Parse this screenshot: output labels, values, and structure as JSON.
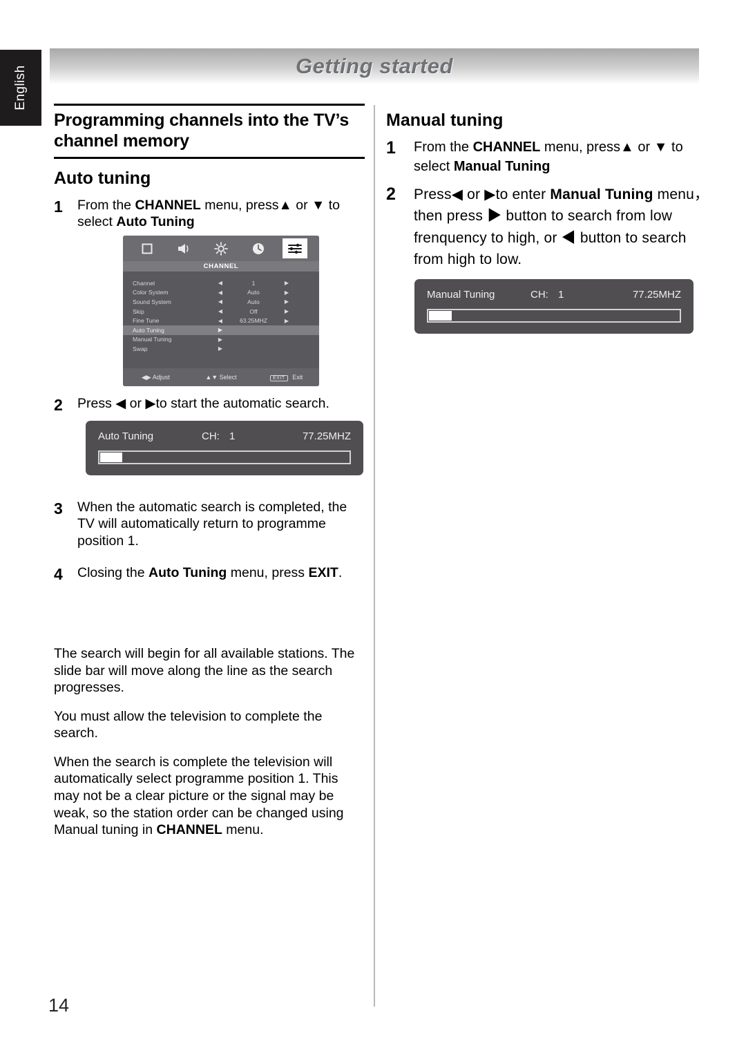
{
  "language_tab": "English",
  "header": {
    "title": "Getting started"
  },
  "page_number": "14",
  "left": {
    "section_title": "Programming channels into the TV’s channel memory",
    "subsection_title": "Auto tuning",
    "steps": [
      {
        "num": "1",
        "parts": [
          {
            "t": "From the ",
            "b": false
          },
          {
            "t": "CHANNEL",
            "b": true
          },
          {
            "t": " menu, press",
            "b": false
          },
          {
            "t": "▲",
            "b": false
          },
          {
            "t": " or ",
            "b": false
          },
          {
            "t": "▼",
            "b": false
          },
          {
            "t": " to select ",
            "b": false
          },
          {
            "t": "Auto Tuning",
            "b": true
          }
        ]
      },
      {
        "num": "2",
        "parts": [
          {
            "t": "Press ",
            "b": false
          },
          {
            "t": "◀",
            "b": false
          },
          {
            "t": " or ",
            "b": false
          },
          {
            "t": "▶",
            "b": false
          },
          {
            "t": "to start the automatic search.",
            "b": false
          }
        ]
      },
      {
        "num": "3",
        "parts": [
          {
            "t": "When the automatic search is completed, the TV will automatically return to programme position 1.",
            "b": false
          }
        ]
      },
      {
        "num": "4",
        "parts": [
          {
            "t": "Closing the ",
            "b": false
          },
          {
            "t": "Auto Tuning",
            "b": true
          },
          {
            "t": " menu, press ",
            "b": false
          },
          {
            "t": "EXIT",
            "b": true
          },
          {
            "t": ".",
            "b": false
          }
        ]
      }
    ],
    "paragraphs": [
      [
        {
          "t": "The search will begin for all available stations. The slide bar will move along the line as the search progresses.",
          "b": false
        }
      ],
      [
        {
          "t": "You must allow the television to complete the search.",
          "b": false
        }
      ],
      [
        {
          "t": "When the search is complete the television will automatically select programme position 1. This may not be a clear picture or the signal may be weak, so the station order can be changed using Manual tuning in ",
          "b": false
        },
        {
          "t": "CHANNEL",
          "b": true
        },
        {
          "t": " menu.",
          "b": false
        }
      ]
    ],
    "auto_tuning_box": {
      "name": "Auto Tuning",
      "ch_label": "CH:",
      "ch_value": "1",
      "frequency": "77.25MHZ",
      "progress_percent": 9
    }
  },
  "right": {
    "subsection_title": "Manual tuning",
    "steps": [
      {
        "num": "1",
        "parts": [
          {
            "t": "From the  ",
            "b": false
          },
          {
            "t": "CHANNEL",
            "b": true
          },
          {
            "t": " menu, press",
            "b": false
          },
          {
            "t": "▲",
            "b": false
          },
          {
            "t": " or ",
            "b": false
          },
          {
            "t": "▼",
            "b": false
          },
          {
            "t": " to select ",
            "b": false
          },
          {
            "t": "Manual Tuning",
            "b": true
          }
        ]
      },
      {
        "num": "2",
        "parts": [
          {
            "t": "Press",
            "b": false
          },
          {
            "t": "◀",
            "b": false
          },
          {
            "t": "  or ",
            "b": false
          },
          {
            "t": "▶",
            "b": false
          },
          {
            "t": "to enter  ",
            "b": false
          },
          {
            "t": "Manual Tuning",
            "b": true
          },
          {
            "t": " menu， then press ",
            "b": false
          },
          {
            "t": "▶",
            "b": false
          },
          {
            "t": " button to search from low frenquency to high, or ",
            "b": false
          },
          {
            "t": "◀",
            "b": false
          },
          {
            "t": " button to search from high to low.",
            "b": false
          }
        ]
      }
    ],
    "manual_tuning_box": {
      "name": "Manual Tuning",
      "ch_label": "CH:",
      "ch_value": "1",
      "frequency": "77.25MHZ",
      "progress_percent": 9
    }
  },
  "osd": {
    "icons": [
      {
        "name": "picture-icon",
        "active": false
      },
      {
        "name": "sound-icon",
        "active": false
      },
      {
        "name": "brightness-icon",
        "active": false
      },
      {
        "name": "time-icon",
        "active": false
      },
      {
        "name": "channel-settings-icon",
        "active": true
      }
    ],
    "menu_title": "CHANNEL",
    "rows": [
      {
        "label": "Channel",
        "left_arrow": "◀",
        "value": "1",
        "right_arrow": "▶",
        "highlighted": false
      },
      {
        "label": "Color System",
        "left_arrow": "◀",
        "value": "Auto",
        "right_arrow": "▶",
        "highlighted": false
      },
      {
        "label": "Sound System",
        "left_arrow": "◀",
        "value": "Auto",
        "right_arrow": "▶",
        "highlighted": false
      },
      {
        "label": "Skip",
        "left_arrow": "◀",
        "value": "Off",
        "right_arrow": "▶",
        "highlighted": false
      },
      {
        "label": "Fine Tune",
        "left_arrow": "◀",
        "value": "63.25MHZ",
        "right_arrow": "▶",
        "highlighted": false
      },
      {
        "label": "Auto Tuning",
        "left_arrow": "▶",
        "value": "",
        "right_arrow": "",
        "highlighted": true
      },
      {
        "label": "Manual Tuning",
        "left_arrow": "▶",
        "value": "",
        "right_arrow": "",
        "highlighted": false
      },
      {
        "label": "Swap",
        "left_arrow": "▶",
        "value": "",
        "right_arrow": "",
        "highlighted": false
      }
    ],
    "footer": {
      "adjust_icon": "◀▶",
      "adjust_label": "Adjust",
      "select_icon": "▲▼",
      "select_label": "Select",
      "exit_key": "EXIT",
      "exit_label": "Exit"
    }
  },
  "colors": {
    "osd_bg": "#59585c",
    "osd_icon_bar": "#6d6c70",
    "osd_title_bar": "#7a7a7e",
    "osd_highlight": "#807f84",
    "tunebox_bg": "#504e50",
    "banner_text": "#6f7175",
    "lang_tab_bg": "#1e1c1d"
  }
}
